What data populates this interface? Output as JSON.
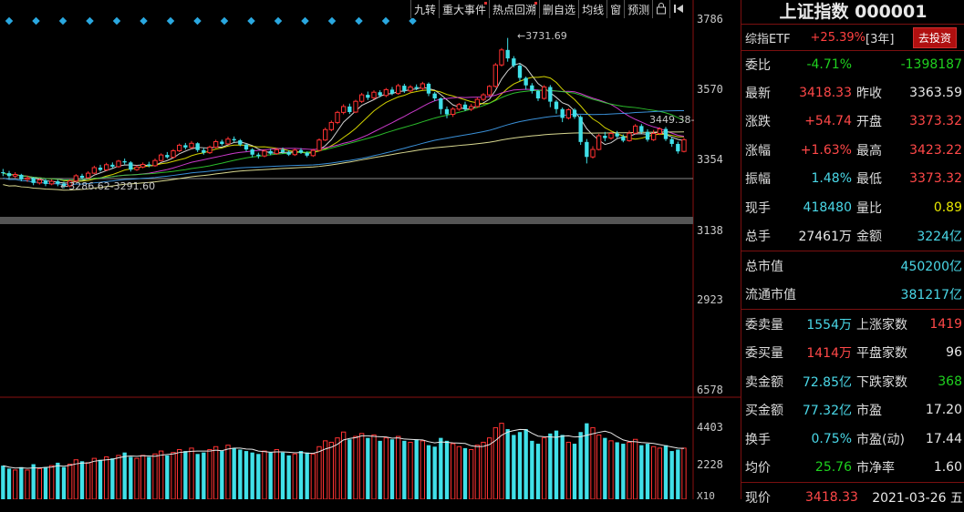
{
  "toolbar": {
    "items": [
      "九转",
      "重大事件",
      "热点回溯",
      "删自选",
      "均线",
      "窗",
      "预测"
    ],
    "lock_icon": "lock-icon",
    "play_icon": "step-back-icon"
  },
  "price_axis": [
    "3786",
    "3570",
    "3354",
    "3138",
    "2923"
  ],
  "volume_axis": [
    "6578",
    "4403",
    "2228",
    "X10"
  ],
  "annotations": {
    "high": "3731.69",
    "low": "3286.62-3291.60",
    "current_line": "3449.38"
  },
  "chart_data": {
    "type": "candlestick",
    "ylim": [
      2923,
      3786
    ],
    "candles": [
      [
        3318,
        3315,
        3328,
        3306
      ],
      [
        3315,
        3306,
        3322,
        3296
      ],
      [
        3306,
        3311,
        3318,
        3300
      ],
      [
        3310,
        3296,
        3313,
        3290
      ],
      [
        3296,
        3300,
        3308,
        3288
      ],
      [
        3300,
        3285,
        3303,
        3278
      ],
      [
        3285,
        3294,
        3299,
        3280
      ],
      [
        3293,
        3282,
        3298,
        3275
      ],
      [
        3282,
        3290,
        3296,
        3278
      ],
      [
        3290,
        3283,
        3295,
        3275
      ],
      [
        3283,
        3276,
        3289,
        3268
      ],
      [
        3276,
        3291,
        3296,
        3272
      ],
      [
        3291,
        3307,
        3312,
        3288
      ],
      [
        3307,
        3301,
        3313,
        3296
      ],
      [
        3301,
        3315,
        3321,
        3298
      ],
      [
        3315,
        3332,
        3338,
        3312
      ],
      [
        3332,
        3325,
        3341,
        3320
      ],
      [
        3325,
        3341,
        3347,
        3322
      ],
      [
        3341,
        3335,
        3348,
        3330
      ],
      [
        3335,
        3352,
        3356,
        3332
      ],
      [
        3352,
        3348,
        3360,
        3342
      ],
      [
        3348,
        3326,
        3352,
        3320
      ],
      [
        3326,
        3334,
        3339,
        3322
      ],
      [
        3334,
        3342,
        3348,
        3330
      ],
      [
        3342,
        3338,
        3350,
        3333
      ],
      [
        3338,
        3354,
        3360,
        3335
      ],
      [
        3354,
        3371,
        3376,
        3351
      ],
      [
        3371,
        3364,
        3380,
        3360
      ],
      [
        3364,
        3384,
        3389,
        3361
      ],
      [
        3384,
        3401,
        3406,
        3380
      ],
      [
        3401,
        3394,
        3408,
        3388
      ],
      [
        3394,
        3407,
        3414,
        3390
      ],
      [
        3407,
        3386,
        3410,
        3380
      ],
      [
        3386,
        3378,
        3392,
        3372
      ],
      [
        3378,
        3395,
        3400,
        3374
      ],
      [
        3395,
        3412,
        3418,
        3392
      ],
      [
        3412,
        3405,
        3418,
        3400
      ],
      [
        3405,
        3420,
        3427,
        3402
      ],
      [
        3420,
        3416,
        3428,
        3410
      ],
      [
        3416,
        3403,
        3420,
        3398
      ],
      [
        3403,
        3388,
        3406,
        3382
      ],
      [
        3388,
        3372,
        3392,
        3364
      ],
      [
        3372,
        3368,
        3378,
        3360
      ],
      [
        3368,
        3383,
        3388,
        3364
      ],
      [
        3383,
        3375,
        3390,
        3370
      ],
      [
        3375,
        3387,
        3392,
        3372
      ],
      [
        3387,
        3380,
        3394,
        3375
      ],
      [
        3380,
        3372,
        3385,
        3368
      ],
      [
        3372,
        3386,
        3390,
        3368
      ],
      [
        3386,
        3378,
        3392,
        3374
      ],
      [
        3378,
        3369,
        3382,
        3364
      ],
      [
        3369,
        3385,
        3390,
        3365
      ],
      [
        3385,
        3417,
        3422,
        3382
      ],
      [
        3417,
        3449,
        3455,
        3414
      ],
      [
        3449,
        3471,
        3477,
        3444
      ],
      [
        3471,
        3502,
        3507,
        3466
      ],
      [
        3502,
        3520,
        3527,
        3496
      ],
      [
        3520,
        3503,
        3529,
        3497
      ],
      [
        3503,
        3536,
        3541,
        3500
      ],
      [
        3536,
        3556,
        3562,
        3531
      ],
      [
        3556,
        3547,
        3566,
        3540
      ],
      [
        3547,
        3564,
        3570,
        3542
      ],
      [
        3564,
        3554,
        3570,
        3548
      ],
      [
        3554,
        3572,
        3577,
        3549
      ],
      [
        3572,
        3560,
        3580,
        3555
      ],
      [
        3560,
        3584,
        3590,
        3556
      ],
      [
        3584,
        3568,
        3590,
        3562
      ],
      [
        3568,
        3580,
        3586,
        3563
      ],
      [
        3580,
        3576,
        3588,
        3570
      ],
      [
        3576,
        3590,
        3596,
        3571
      ],
      [
        3590,
        3560,
        3594,
        3552
      ],
      [
        3560,
        3545,
        3565,
        3537
      ],
      [
        3545,
        3512,
        3548,
        3496
      ],
      [
        3512,
        3496,
        3520,
        3484
      ],
      [
        3496,
        3512,
        3518,
        3488
      ],
      [
        3512,
        3526,
        3531,
        3507
      ],
      [
        3526,
        3512,
        3535,
        3506
      ],
      [
        3512,
        3520,
        3528,
        3506
      ],
      [
        3520,
        3542,
        3548,
        3516
      ],
      [
        3542,
        3556,
        3561,
        3537
      ],
      [
        3556,
        3582,
        3586,
        3551
      ],
      [
        3582,
        3648,
        3654,
        3578
      ],
      [
        3648,
        3694,
        3700,
        3643
      ],
      [
        3694,
        3668,
        3731,
        3658
      ],
      [
        3668,
        3646,
        3675,
        3640
      ],
      [
        3646,
        3608,
        3652,
        3598
      ],
      [
        3608,
        3585,
        3612,
        3572
      ],
      [
        3585,
        3568,
        3592,
        3560
      ],
      [
        3568,
        3545,
        3572,
        3537
      ],
      [
        3545,
        3580,
        3586,
        3541
      ],
      [
        3580,
        3535,
        3586,
        3518
      ],
      [
        3535,
        3512,
        3540,
        3498
      ],
      [
        3512,
        3485,
        3517,
        3472
      ],
      [
        3485,
        3510,
        3515,
        3480
      ],
      [
        3510,
        3488,
        3515,
        3482
      ],
      [
        3488,
        3411,
        3493,
        3402
      ],
      [
        3411,
        3365,
        3420,
        3345
      ],
      [
        3365,
        3388,
        3398,
        3360
      ],
      [
        3388,
        3430,
        3436,
        3385
      ],
      [
        3430,
        3423,
        3442,
        3413
      ],
      [
        3423,
        3437,
        3443,
        3418
      ],
      [
        3437,
        3428,
        3445,
        3423
      ],
      [
        3428,
        3415,
        3434,
        3410
      ],
      [
        3415,
        3438,
        3446,
        3412
      ],
      [
        3438,
        3460,
        3466,
        3435
      ],
      [
        3460,
        3442,
        3466,
        3437
      ],
      [
        3442,
        3418,
        3450,
        3412
      ],
      [
        3418,
        3437,
        3448,
        3414
      ],
      [
        3437,
        3451,
        3456,
        3432
      ],
      [
        3451,
        3420,
        3457,
        3414
      ],
      [
        3420,
        3405,
        3427,
        3396
      ],
      [
        3405,
        3382,
        3412,
        3375
      ],
      [
        3382,
        3418,
        3423,
        3379
      ]
    ],
    "volumes": [
      2.3,
      2.1,
      2.0,
      2.2,
      2.0,
      2.4,
      2.1,
      2.2,
      2.3,
      2.5,
      2.2,
      2.4,
      2.7,
      2.6,
      2.5,
      2.8,
      2.7,
      2.9,
      2.8,
      3.0,
      3.2,
      2.9,
      2.8,
      3.0,
      2.9,
      3.1,
      3.3,
      3.0,
      3.2,
      3.4,
      3.3,
      3.5,
      3.1,
      3.2,
      3.4,
      3.6,
      3.3,
      3.7,
      3.5,
      3.4,
      3.3,
      3.2,
      3.1,
      3.3,
      3.2,
      3.4,
      3.2,
      3.0,
      3.1,
      3.3,
      3.2,
      3.1,
      3.6,
      4.0,
      3.9,
      4.2,
      4.6,
      4.1,
      4.3,
      4.5,
      4.2,
      4.4,
      4.0,
      4.2,
      4.1,
      4.3,
      4.0,
      3.9,
      4.1,
      4.0,
      3.7,
      3.6,
      4.2,
      4.0,
      3.8,
      3.6,
      3.5,
      3.4,
      3.7,
      3.9,
      4.2,
      4.9,
      5.2,
      4.8,
      4.4,
      4.6,
      4.8,
      4.0,
      3.8,
      4.2,
      4.5,
      4.7,
      4.4,
      3.9,
      3.8,
      4.6,
      5.2,
      4.9,
      4.4,
      4.2,
      4.0,
      3.9,
      3.8,
      3.9,
      4.1,
      3.7,
      3.8,
      3.6,
      3.5,
      3.7,
      3.3,
      3.4,
      3.5
    ],
    "ma_colors": [
      "#e8e8e8",
      "#e8e800",
      "#e040e0",
      "#30d030",
      "#40a0f0",
      "#f0f0a0"
    ]
  },
  "stock": {
    "title": "上证指数 000001",
    "etf": {
      "name": "综指ETF",
      "change": "+25.39%",
      "period": "[3年]",
      "button": "去投资"
    }
  },
  "quote_rows": [
    {
      "l1": "委比",
      "v1": "-4.71%",
      "c1": "green",
      "l2": "",
      "v2": "-1398187",
      "c2": "green"
    },
    {
      "l1": "最新",
      "v1": "3418.33",
      "c1": "red",
      "l2": "昨收",
      "v2": "3363.59",
      "c2": "white"
    },
    {
      "l1": "涨跌",
      "v1": "+54.74",
      "c1": "red",
      "l2": "开盘",
      "v2": "3373.32",
      "c2": "red"
    },
    {
      "l1": "涨幅",
      "v1": "+1.63%",
      "c1": "red",
      "l2": "最高",
      "v2": "3423.22",
      "c2": "red"
    },
    {
      "l1": "振幅",
      "v1": "1.48%",
      "c1": "cyan",
      "l2": "最低",
      "v2": "3373.32",
      "c2": "red"
    },
    {
      "l1": "现手",
      "v1": "418480",
      "c1": "cyan",
      "l2": "量比",
      "v2": "0.89",
      "c2": "yellow"
    },
    {
      "l1": "总手",
      "v1": "27461万",
      "c1": "white",
      "l2": "金额",
      "v2": "3224亿",
      "c2": "cyan"
    }
  ],
  "market_value": [
    {
      "label": "总市值",
      "value": "450200亿"
    },
    {
      "label": "流通市值",
      "value": "381217亿"
    }
  ],
  "breadth_rows": [
    {
      "l1": "委卖量",
      "v1": "1554万",
      "c1": "cyan",
      "l2": "上涨家数",
      "v2": "1419",
      "c2": "red"
    },
    {
      "l1": "委买量",
      "v1": "1414万",
      "c1": "red",
      "l2": "平盘家数",
      "v2": "96",
      "c2": "white"
    },
    {
      "l1": "卖金额",
      "v1": "72.85亿",
      "c1": "cyan",
      "l2": "下跌家数",
      "v2": "368",
      "c2": "green"
    },
    {
      "l1": "买金额",
      "v1": "77.32亿",
      "c1": "cyan",
      "l2": "市盈",
      "v2": "17.20",
      "c2": "white"
    },
    {
      "l1": "换手",
      "v1": "0.75%",
      "c1": "cyan",
      "l2": "市盈(动)",
      "v2": "17.44",
      "c2": "white"
    },
    {
      "l1": "均价",
      "v1": "25.76",
      "c1": "green",
      "l2": "市净率",
      "v2": "1.60",
      "c2": "white"
    }
  ],
  "footer": {
    "label": "现价",
    "value": "3418.33",
    "date": "2021-03-26 五"
  }
}
